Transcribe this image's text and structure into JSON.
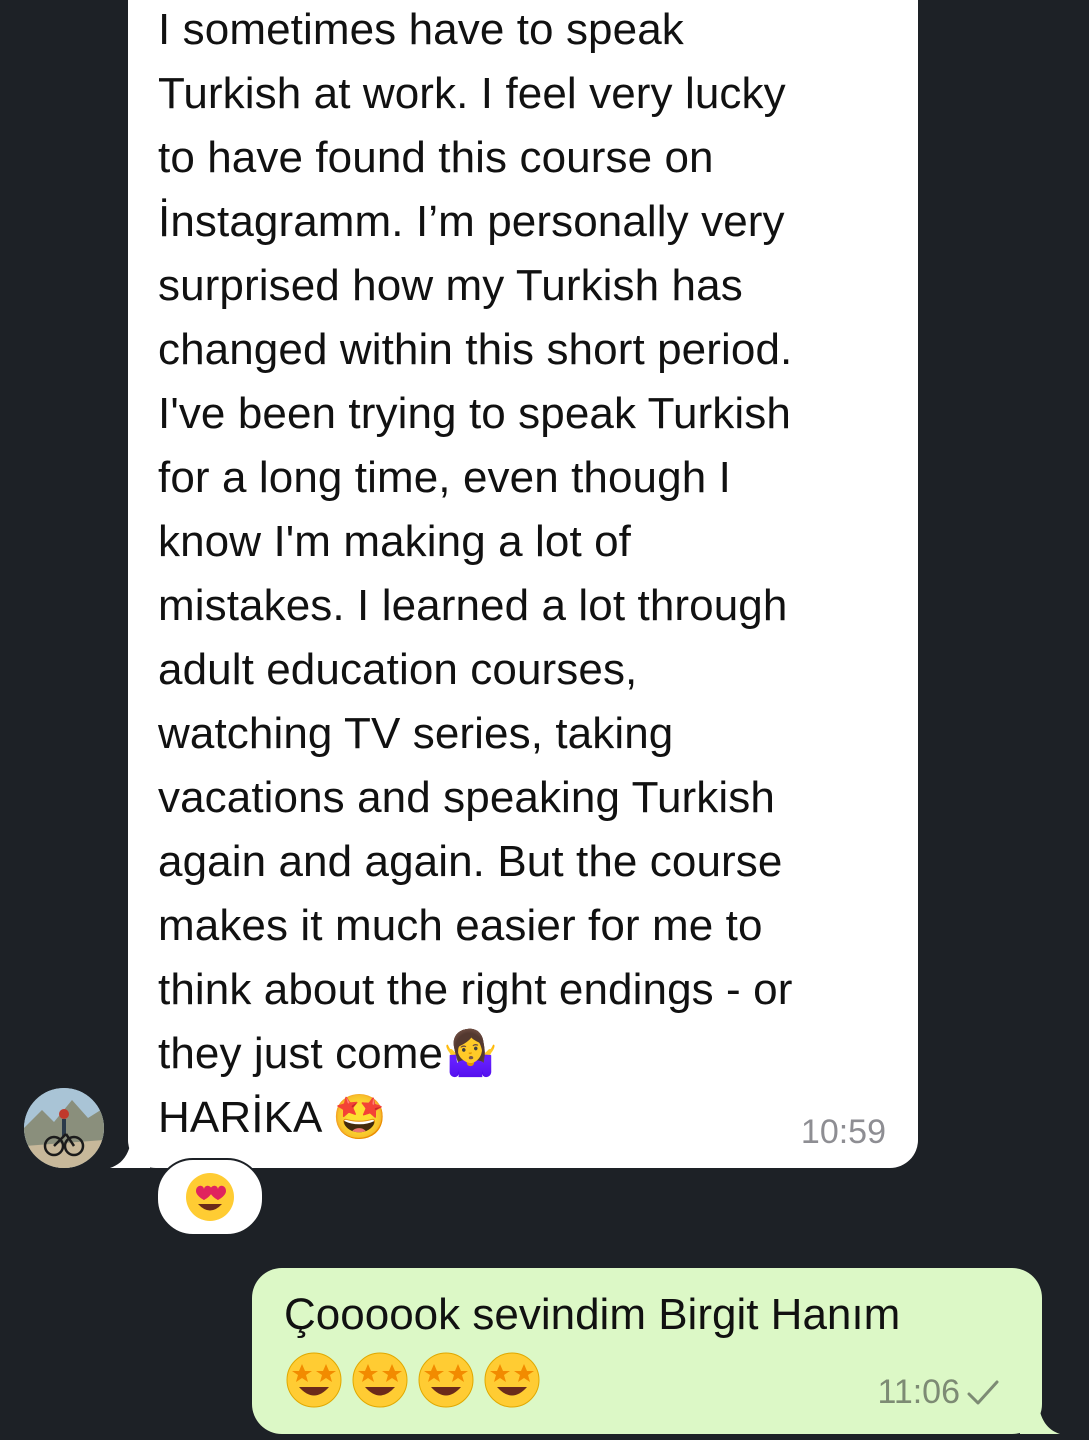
{
  "incoming": {
    "text": "I sometimes have to speak\nTurkish at work. I feel very lucky\nto have found this course on\nİnstagramm. I’m personally very\nsurprised how my Turkish has\nchanged within this short period.\nI've been trying to speak Turkish\nfor a long time, even though I\nknow I'm making a lot of\nmistakes. I learned a lot through\nadult education courses,\nwatching TV series, taking\nvacations and speaking Turkish\nagain and again. But the course\nmakes it much easier for me to\nthink about the right endings - or\nthey just come",
    "shrug_emoji": "🤷‍♀️",
    "last_line": "HARİKA",
    "last_emoji": "🤩",
    "time": "10:59",
    "reaction": "😍"
  },
  "outgoing": {
    "text": "Çoooook sevindim Birgit Hanım",
    "emojis": [
      "🤩",
      "🤩",
      "🤩",
      "🤩"
    ],
    "time": "11:06"
  },
  "colors": {
    "background": "#1d2126",
    "incoming_bubble": "#ffffff",
    "outgoing_bubble": "#dcf8c6"
  }
}
